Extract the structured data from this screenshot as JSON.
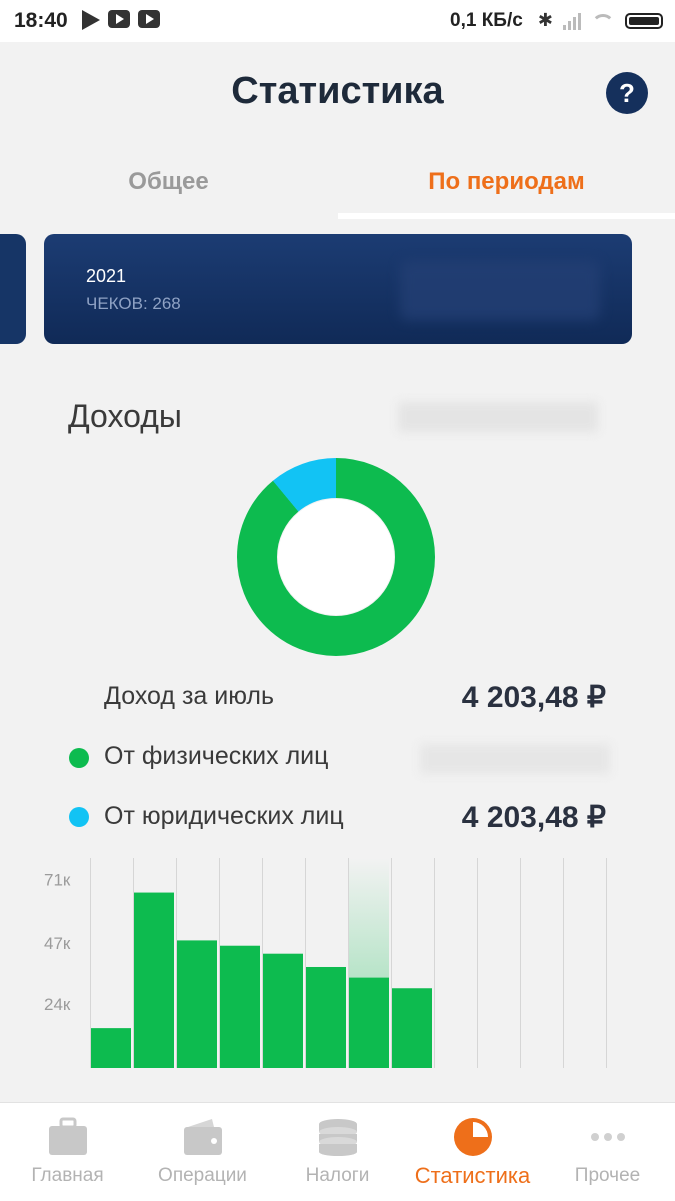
{
  "status_bar": {
    "time": "18:40",
    "network_speed": "0,1 КБ/с",
    "icons": [
      "arrow-app-icon",
      "youtube-icon",
      "youtube-icon",
      "bluetooth-icon",
      "signal-icon",
      "wifi-icon",
      "battery-icon"
    ]
  },
  "header": {
    "title": "Статистика",
    "help_label": "?"
  },
  "tabs": [
    {
      "label": "Общее",
      "active": false
    },
    {
      "label": "По периодам",
      "active": true
    }
  ],
  "period_card": {
    "year": "2021",
    "checks": "ЧЕКОВ: 268"
  },
  "income": {
    "title": "Доходы",
    "month_label": "Доход за июль",
    "month_amount": "4 203,48 ₽",
    "individuals_label": "От физических лиц",
    "legal_label": "От юридических лиц",
    "legal_amount": "4 203,48 ₽",
    "colors": {
      "individuals": "#0dbb4f",
      "legal": "#12c3f4"
    }
  },
  "donut": {
    "segments": [
      {
        "name": "individuals",
        "fraction": 0.89,
        "color": "#0dbb4f"
      },
      {
        "name": "legal",
        "fraction": 0.11,
        "color": "#12c3f4"
      }
    ]
  },
  "chart_data": {
    "type": "bar",
    "categories": [
      "",
      "",
      "",
      "",
      "",
      "",
      "",
      "",
      "",
      "",
      "",
      ""
    ],
    "values": [
      15,
      66,
      48,
      46,
      43,
      38,
      34,
      30,
      null,
      null,
      null,
      null
    ],
    "y_ticks": [
      "71к",
      "47к",
      "24к"
    ],
    "y_tick_values": [
      71,
      47,
      24
    ],
    "ylim": [
      0,
      79
    ],
    "selected_index": 6,
    "bar_color": "#0dbb4f",
    "grid": true
  },
  "bottom_nav": [
    {
      "label": "Главная",
      "icon": "briefcase-icon",
      "active": false
    },
    {
      "label": "Операции",
      "icon": "wallet-icon",
      "active": false
    },
    {
      "label": "Налоги",
      "icon": "coins-icon",
      "active": false
    },
    {
      "label": "Статистика",
      "icon": "pie-chart-icon",
      "active": true
    },
    {
      "label": "Прочее",
      "icon": "more-dots-icon",
      "active": false
    }
  ]
}
